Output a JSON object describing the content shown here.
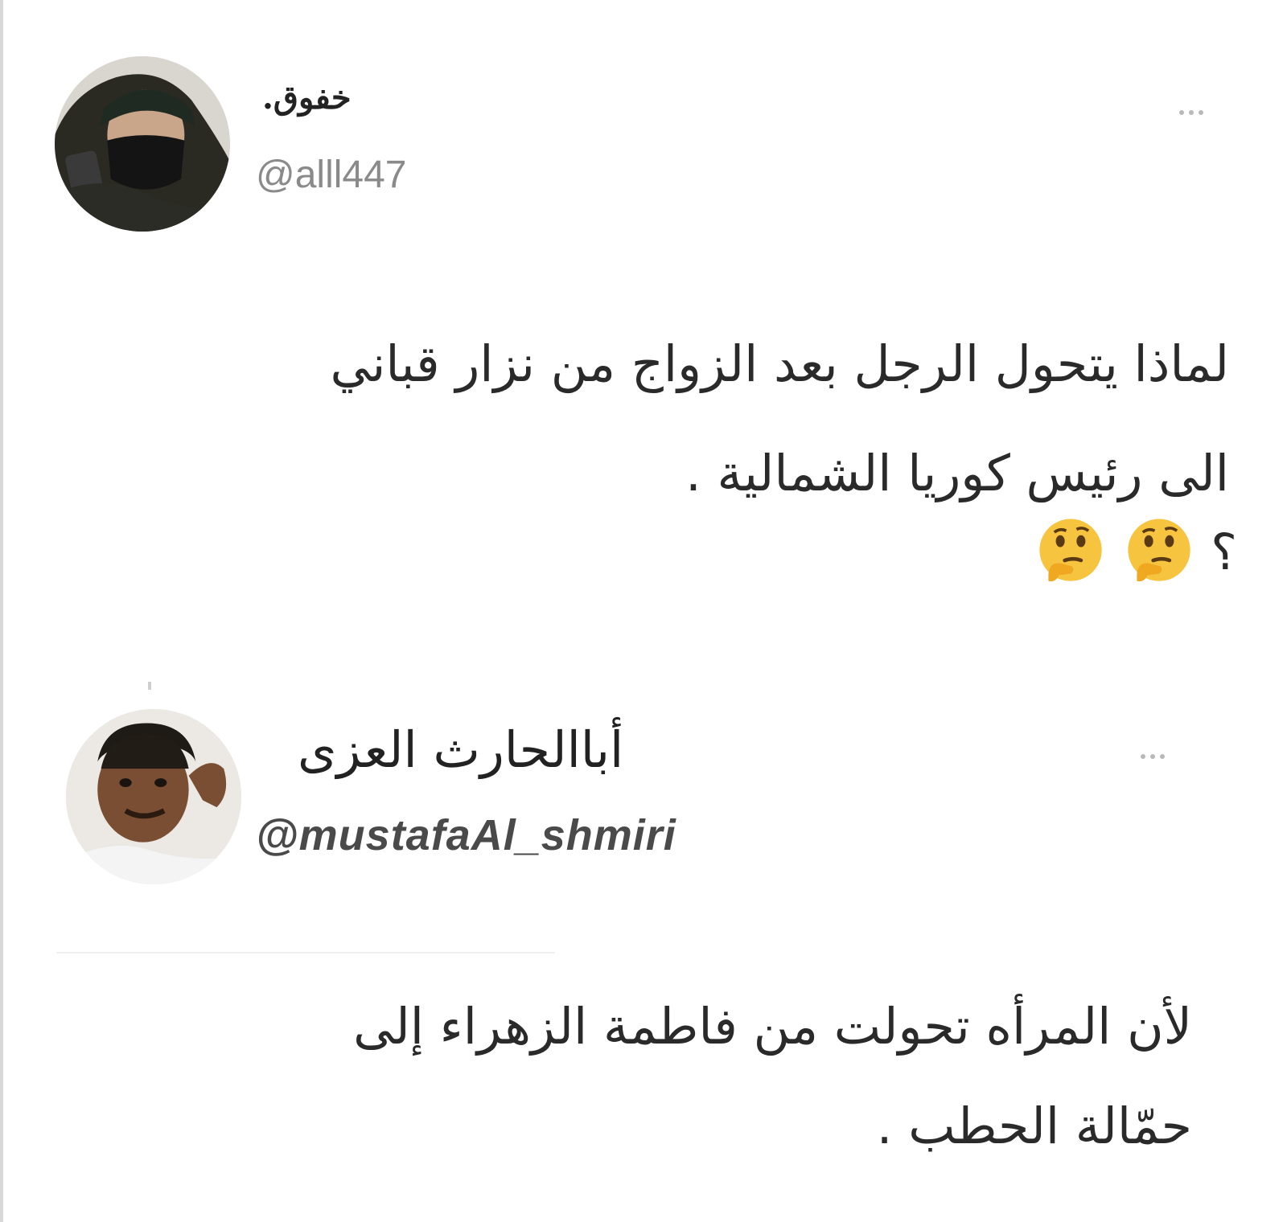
{
  "tweets": [
    {
      "display_name": "خفوق.",
      "handle": "@alll447",
      "text_lines": [
        "لماذا يتحول الرجل بعد الزواج من نزار قباني",
        "الى رئيس كوريا الشمالية ."
      ],
      "trailing_text": "؟",
      "emojis": [
        "thinking-face",
        "thinking-face"
      ],
      "colors": {
        "name": "#222222",
        "handle": "#8a8a8a",
        "text": "#2a2a2a"
      }
    },
    {
      "display_name": "أباالحارث العزى",
      "handle": "@mustafaAl_shmiri",
      "text_lines": [
        "لأن المرأه تحولت من فاطمة الزهراء إلى",
        "حمّالة الحطب ."
      ],
      "colors": {
        "name": "#222222",
        "handle": "#4a4a4a",
        "text": "#2a2a2a"
      }
    }
  ],
  "icons": {
    "more": "more-horizontal-icon",
    "emoji": "thinking-face-emoji"
  },
  "background": "#ffffff"
}
